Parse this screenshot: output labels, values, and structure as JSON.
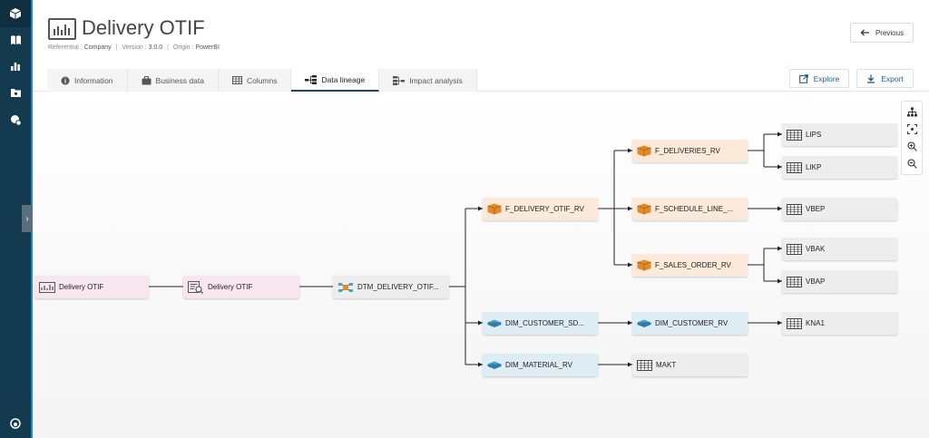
{
  "header": {
    "title": "Delivery OTIF",
    "meta": {
      "referential_label": "Referential :",
      "referential_value": "Company",
      "version_label": "Version :",
      "version_value": "3.0.0",
      "origin_label": "Origin :",
      "origin_value": "PowerBI"
    },
    "previous_label": "Previous",
    "explore_label": "Explore",
    "export_label": "Export"
  },
  "tabs": [
    {
      "label": "Information",
      "icon": "info-icon"
    },
    {
      "label": "Business data",
      "icon": "briefcase-icon"
    },
    {
      "label": "Columns",
      "icon": "table-icon"
    },
    {
      "label": "Data lineage",
      "icon": "lineage-icon",
      "active": true
    },
    {
      "label": "Impact analysis",
      "icon": "impact-icon"
    }
  ],
  "sidebar": {
    "icons": [
      "box-logo-icon",
      "book-icon",
      "bar-chart-icon",
      "folder-icon",
      "settings-badge-icon",
      "support-icon"
    ]
  },
  "lineage": {
    "nodes": {
      "report": "Delivery OTIF",
      "dataset": "Delivery OTIF",
      "dtm": "DTM_DELIVERY_OTIF...",
      "f_delivery": "F_DELIVERY_OTIF_RV",
      "dim_customer_sd": "DIM_CUSTOMER_SD...",
      "dim_material": "DIM_MATERIAL_RV",
      "f_deliveries": "F_DELIVERIES_RV",
      "f_schedule": "F_SCHEDULE_LINE_...",
      "f_sales_order": "F_SALES_ORDER_RV",
      "dim_customer": "DIM_CUSTOMER_RV",
      "makt": "MAKT",
      "lips": "LIPS",
      "likp": "LIKP",
      "vbep": "VBEP",
      "vbak": "VBAK",
      "vbap": "VBAP",
      "kna1": "KNA1"
    }
  },
  "colors": {
    "rail": "#143a4f",
    "accent": "#1e88c7",
    "pink_node": "#f7e6ef",
    "orange_node": "#fbeada",
    "blue_node": "#deedf4",
    "gray_node": "#ededed"
  }
}
